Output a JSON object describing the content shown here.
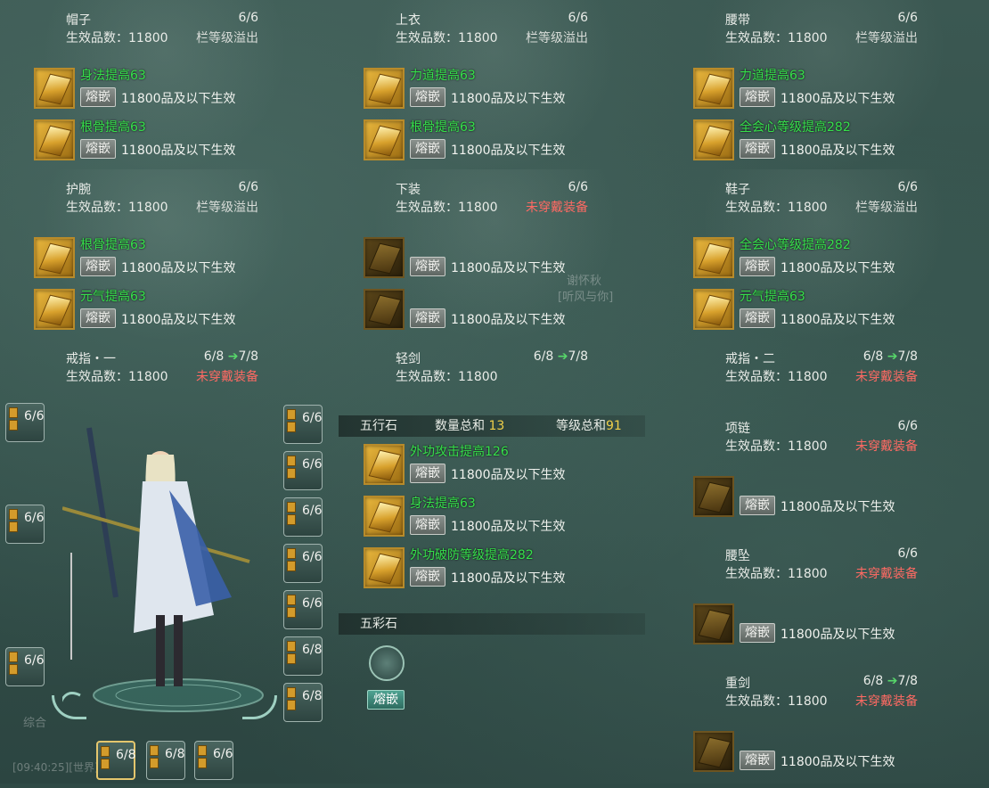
{
  "labels": {
    "eff_prefix": "生效品数：",
    "fuse": "熔嵌",
    "eff_text": "11800品及以下生效",
    "arrow": "➔"
  },
  "cells": [
    {
      "name": "帽子",
      "count": "6/6",
      "quality": "11800",
      "status": "栏等级溢出",
      "status_type": "grey",
      "gems": [
        {
          "attr": "身法提高63",
          "dark": false
        },
        {
          "attr": "根骨提高63",
          "dark": false
        }
      ]
    },
    {
      "name": "上衣",
      "count": "6/6",
      "quality": "11800",
      "status": "栏等级溢出",
      "status_type": "grey",
      "gems": [
        {
          "attr": "力道提高63",
          "dark": false
        },
        {
          "attr": "根骨提高63",
          "dark": false
        }
      ]
    },
    {
      "name": "腰带",
      "count": "6/6",
      "quality": "11800",
      "status": "栏等级溢出",
      "status_type": "grey",
      "gems": [
        {
          "attr": "力道提高63",
          "dark": false
        },
        {
          "attr": "全会心等级提高282",
          "dark": false
        }
      ]
    },
    {
      "name": "护腕",
      "count": "6/6",
      "quality": "11800",
      "status": "栏等级溢出",
      "status_type": "grey",
      "gems": [
        {
          "attr": "根骨提高63",
          "dark": false
        },
        {
          "attr": "元气提高63",
          "dark": false
        }
      ]
    },
    {
      "name": "下装",
      "count": "6/6",
      "quality": "11800",
      "status": "未穿戴装备",
      "status_type": "red",
      "gems": [
        {
          "attr": "",
          "dark": true
        },
        {
          "attr": "",
          "dark": true
        }
      ]
    },
    {
      "name": "鞋子",
      "count": "6/6",
      "quality": "11800",
      "status": "栏等级溢出",
      "status_type": "grey",
      "gems": [
        {
          "attr": "全会心等级提高282",
          "dark": false
        },
        {
          "attr": "元气提高63",
          "dark": false
        }
      ]
    }
  ],
  "ring1": {
    "name": "戒指・一",
    "count": "6/8",
    "next": "7/8",
    "quality": "11800",
    "status": "未穿戴装备"
  },
  "sword": {
    "name": "轻剑",
    "count": "6/8",
    "next": "7/8",
    "quality": "11800"
  },
  "ring2": {
    "name": "戒指・二",
    "count": "6/8",
    "next": "7/8",
    "quality": "11800",
    "status": "未穿戴装备"
  },
  "necklace": {
    "name": "项链",
    "count": "6/6",
    "quality": "11800",
    "status": "未穿戴装备"
  },
  "pendant": {
    "name": "腰坠",
    "count": "6/6",
    "quality": "11800",
    "status": "未穿戴装备"
  },
  "heavy": {
    "name": "重剑",
    "count": "6/8",
    "next": "7/8",
    "quality": "11800",
    "status": "未穿戴装备"
  },
  "wuxing": {
    "title": "五行石",
    "qty_label": "数量总和",
    "qty": "13",
    "lvl_label": "等级总和",
    "lvl": "91",
    "gems": [
      {
        "attr": "外功攻击提高126"
      },
      {
        "attr": "身法提高63"
      },
      {
        "attr": "外功破防等级提高282"
      }
    ]
  },
  "wucai": {
    "title": "五彩石",
    "button": "熔嵌"
  },
  "slots_left": [
    "6/6",
    "6/6",
    "6/6"
  ],
  "slots_right": [
    "6/6",
    "6/6",
    "6/6",
    "6/6",
    "6/6",
    "6/8",
    "6/8"
  ],
  "slots_bottom": [
    "6/8",
    "6/8",
    "6/6"
  ],
  "background_text": {
    "chat1": "综合",
    "name1": "谢怀秋",
    "name2": "[听风与你]",
    "chat2": "[09:40:25][世界]"
  }
}
